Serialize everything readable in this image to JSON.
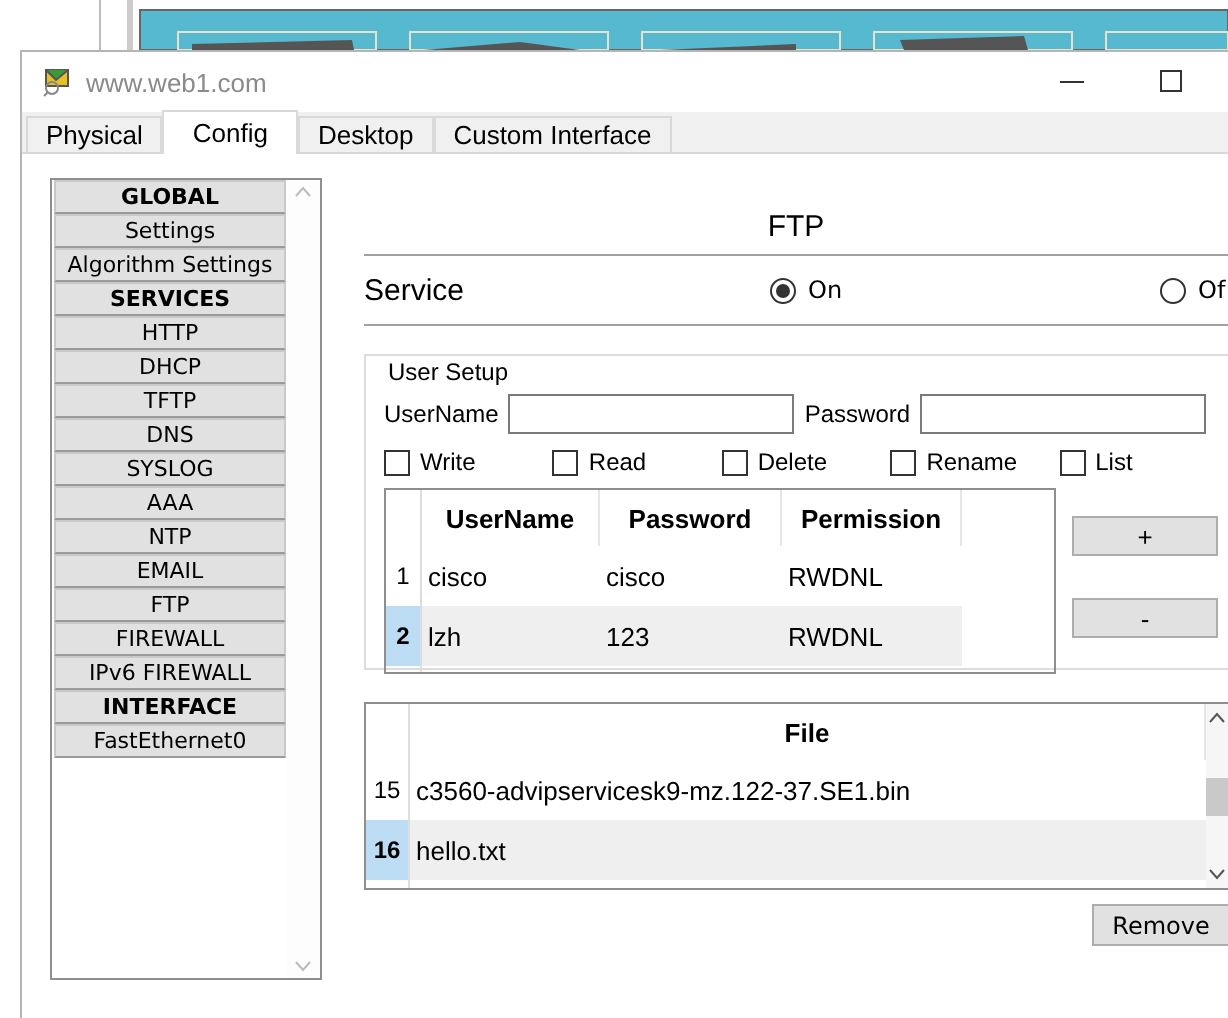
{
  "window": {
    "title": "www.web1.com"
  },
  "tabs": [
    {
      "label": "Physical",
      "selected": false
    },
    {
      "label": "Config",
      "selected": true
    },
    {
      "label": "Desktop",
      "selected": false
    },
    {
      "label": "Custom Interface",
      "selected": false
    }
  ],
  "sidebar": {
    "items": [
      {
        "kind": "header",
        "label": "GLOBAL"
      },
      {
        "kind": "item",
        "label": "Settings"
      },
      {
        "kind": "item",
        "label": "Algorithm Settings"
      },
      {
        "kind": "header",
        "label": "SERVICES"
      },
      {
        "kind": "item",
        "label": "HTTP"
      },
      {
        "kind": "item",
        "label": "DHCP"
      },
      {
        "kind": "item",
        "label": "TFTP"
      },
      {
        "kind": "item",
        "label": "DNS"
      },
      {
        "kind": "item",
        "label": "SYSLOG"
      },
      {
        "kind": "item",
        "label": "AAA"
      },
      {
        "kind": "item",
        "label": "NTP"
      },
      {
        "kind": "item",
        "label": "EMAIL"
      },
      {
        "kind": "item",
        "label": "FTP"
      },
      {
        "kind": "item",
        "label": "FIREWALL"
      },
      {
        "kind": "item",
        "label": "IPv6 FIREWALL"
      },
      {
        "kind": "header",
        "label": "INTERFACE"
      },
      {
        "kind": "item",
        "label": "FastEthernet0"
      }
    ]
  },
  "panel_title": "FTP",
  "service": {
    "label": "Service",
    "options": [
      {
        "label": "On",
        "selected": true
      },
      {
        "label": "Of",
        "selected": false
      }
    ]
  },
  "user_setup": {
    "legend": "User Setup",
    "fields": [
      {
        "label": "UserName"
      },
      {
        "label": "Password"
      }
    ],
    "permissions": [
      {
        "label": "Write",
        "checked": false
      },
      {
        "label": "Read",
        "checked": false
      },
      {
        "label": "Delete",
        "checked": false
      },
      {
        "label": "Rename",
        "checked": false
      },
      {
        "label": "List",
        "checked": false
      }
    ],
    "users": {
      "columns": [
        "UserName",
        "Password",
        "Permission"
      ],
      "rows": [
        {
          "index": "1",
          "cells": [
            "cisco",
            "cisco",
            "RWDNL"
          ],
          "selected": false
        },
        {
          "index": "2",
          "cells": [
            "lzh",
            "123",
            "RWDNL"
          ],
          "selected": true
        }
      ]
    },
    "buttons": [
      "+",
      "-"
    ]
  },
  "files": {
    "column": "File",
    "rows": [
      {
        "index": "15",
        "name": "c3560-advipservicesk9-mz.122-37.SE1.bin",
        "selected": false
      },
      {
        "index": "16",
        "name": "hello.txt",
        "selected": true
      }
    ]
  },
  "remove_button": "Remove"
}
